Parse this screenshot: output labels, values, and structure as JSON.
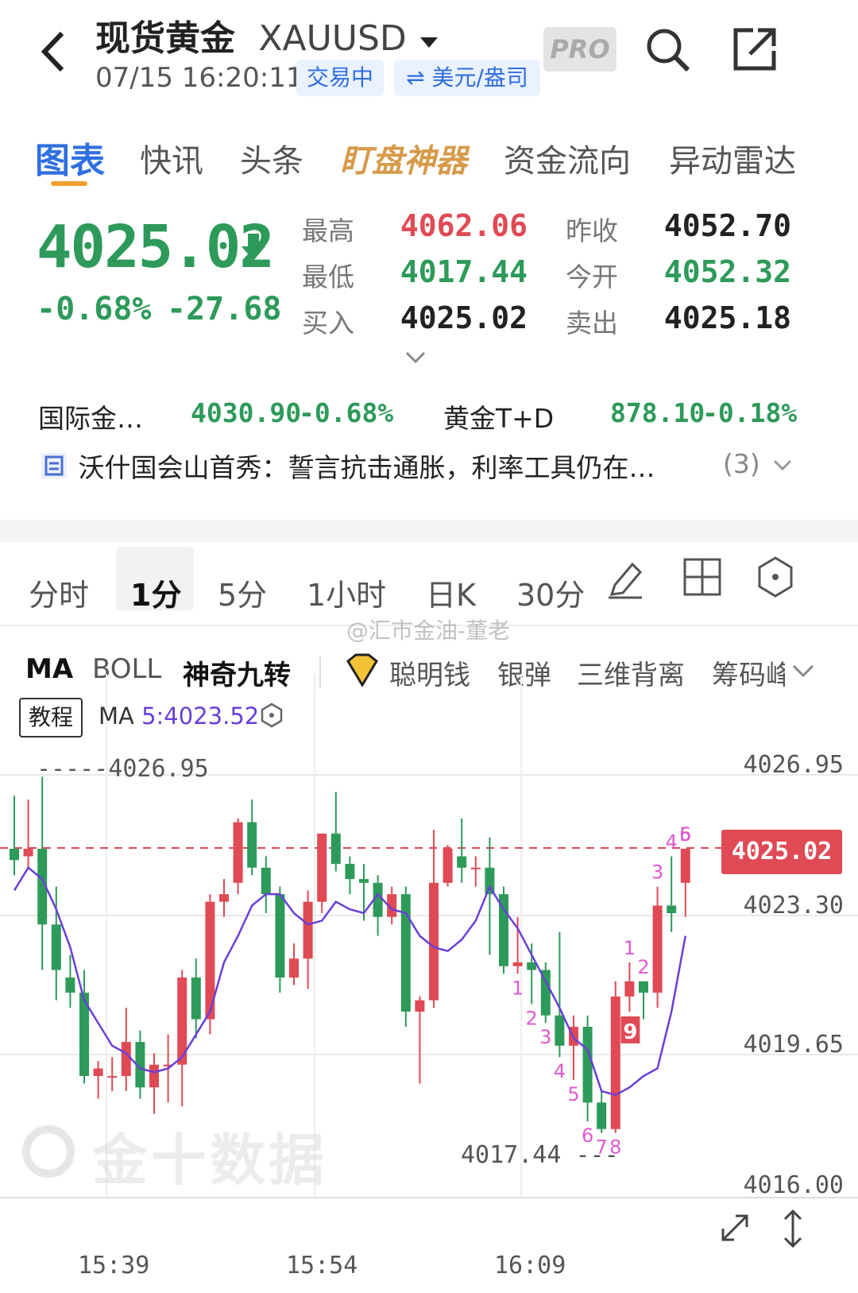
{
  "header": {
    "title": "现货黄金",
    "symbol": "XAUUSD",
    "datetime": "07/15 16:20:11",
    "status": "交易中",
    "unit": "⇌ 美元/盎司",
    "pro_label": "PRO"
  },
  "tabs": [
    "图表",
    "快讯",
    "头条",
    "盯盘神器",
    "资金流向",
    "异动雷达"
  ],
  "quote": {
    "price": "4025.02",
    "change_pct": "-0.68%",
    "change": "-27.68",
    "stats": [
      {
        "label": "最高",
        "value": "4062.06",
        "color": "red"
      },
      {
        "label": "昨收",
        "value": "4052.70",
        "color": "dark"
      },
      {
        "label": "最低",
        "value": "4017.44",
        "color": "green"
      },
      {
        "label": "今开",
        "value": "4052.32",
        "color": "green"
      },
      {
        "label": "买入",
        "value": "4025.02",
        "color": "dark"
      },
      {
        "label": "卖出",
        "value": "4025.18",
        "color": "dark"
      }
    ]
  },
  "related": [
    {
      "name": "国际金…",
      "price": "4030.90",
      "pct": "-0.68%"
    },
    {
      "name": "黄金T+D",
      "price": "878.10",
      "pct": "-0.18%"
    }
  ],
  "news": {
    "text": "沃什国会山首秀：誓言抗击通胀，利率工具仍在…",
    "count": "(3)"
  },
  "period_tabs": [
    "分时",
    "1分",
    "5分",
    "1小时",
    "日K",
    "30分"
  ],
  "indicator_tabs": [
    "MA",
    "BOLL",
    "神奇九转",
    "聪明钱",
    "银弹",
    "三维背离",
    "筹码峰"
  ],
  "watermark": "@汇市金油-董老",
  "chart_header": {
    "tutorial": "教程",
    "ma_label": "MA",
    "ma_value": "5:4023.52"
  },
  "chart_data": {
    "type": "candlestick",
    "y_axis_labels": [
      "4026.95",
      "4023.30",
      "4019.65",
      "4016.00"
    ],
    "ylim": [
      4016.0,
      4026.95
    ],
    "x_tick_labels": [
      "15:39",
      "15:54",
      "16:09"
    ],
    "current_price": "4025.02",
    "high_marker": "4026.95",
    "low_marker": "4017.44",
    "candles": [
      {
        "o": 4025.0,
        "h": 4026.4,
        "l": 4024.3,
        "c": 4024.7
      },
      {
        "o": 4024.8,
        "h": 4026.3,
        "l": 4024.5,
        "c": 4025.0
      },
      {
        "o": 4025.0,
        "h": 4026.9,
        "l": 4021.8,
        "c": 4023.0
      },
      {
        "o": 4023.0,
        "h": 4024.0,
        "l": 4021.0,
        "c": 4021.8
      },
      {
        "o": 4021.6,
        "h": 4022.2,
        "l": 4020.8,
        "c": 4021.2
      },
      {
        "o": 4021.2,
        "h": 4021.8,
        "l": 4018.8,
        "c": 4019.0
      },
      {
        "o": 4019.0,
        "h": 4019.4,
        "l": 4018.4,
        "c": 4019.2
      },
      {
        "o": 4019.0,
        "h": 4019.5,
        "l": 4018.6,
        "c": 4019.0
      },
      {
        "o": 4019.0,
        "h": 4020.8,
        "l": 4018.6,
        "c": 4019.9
      },
      {
        "o": 4019.9,
        "h": 4020.2,
        "l": 4018.4,
        "c": 4018.7
      },
      {
        "o": 4018.7,
        "h": 4019.6,
        "l": 4018.0,
        "c": 4019.3
      },
      {
        "o": 4019.3,
        "h": 4020.1,
        "l": 4018.3,
        "c": 4019.3
      },
      {
        "o": 4019.3,
        "h": 4021.8,
        "l": 4018.2,
        "c": 4021.6
      },
      {
        "o": 4021.6,
        "h": 4022.1,
        "l": 4020.0,
        "c": 4020.5
      },
      {
        "o": 4020.5,
        "h": 4023.8,
        "l": 4020.1,
        "c": 4023.6
      },
      {
        "o": 4023.6,
        "h": 4024.2,
        "l": 4023.2,
        "c": 4023.8
      },
      {
        "o": 4024.1,
        "h": 4025.8,
        "l": 4023.8,
        "c": 4025.7
      },
      {
        "o": 4025.7,
        "h": 4026.3,
        "l": 4024.3,
        "c": 4024.5
      },
      {
        "o": 4024.5,
        "h": 4024.8,
        "l": 4023.3,
        "c": 4023.8
      },
      {
        "o": 4023.8,
        "h": 4024.0,
        "l": 4021.2,
        "c": 4021.6
      },
      {
        "o": 4021.6,
        "h": 4022.5,
        "l": 4021.4,
        "c": 4022.1
      },
      {
        "o": 4022.1,
        "h": 4023.9,
        "l": 4021.3,
        "c": 4023.6
      },
      {
        "o": 4023.6,
        "h": 4025.4,
        "l": 4023.3,
        "c": 4025.4
      },
      {
        "o": 4025.4,
        "h": 4026.5,
        "l": 4024.4,
        "c": 4024.6
      },
      {
        "o": 4024.6,
        "h": 4024.8,
        "l": 4023.8,
        "c": 4024.2
      },
      {
        "o": 4024.2,
        "h": 4024.6,
        "l": 4023.1,
        "c": 4024.1
      },
      {
        "o": 4024.1,
        "h": 4024.3,
        "l": 4022.7,
        "c": 4023.2
      },
      {
        "o": 4023.2,
        "h": 4024.0,
        "l": 4023.0,
        "c": 4023.8
      },
      {
        "o": 4023.8,
        "h": 4024.0,
        "l": 4020.3,
        "c": 4020.7
      },
      {
        "o": 4020.7,
        "h": 4021.1,
        "l": 4018.8,
        "c": 4021.0
      },
      {
        "o": 4021.0,
        "h": 4025.5,
        "l": 4020.8,
        "c": 4024.1
      },
      {
        "o": 4024.1,
        "h": 4025.1,
        "l": 4024.0,
        "c": 4025.0
      },
      {
        "o": 4024.8,
        "h": 4025.8,
        "l": 4024.1,
        "c": 4024.5
      },
      {
        "o": 4024.5,
        "h": 4024.8,
        "l": 4024.0,
        "c": 4024.5
      },
      {
        "o": 4024.5,
        "h": 4025.3,
        "l": 4022.2,
        "c": 4023.8
      },
      {
        "o": 4023.8,
        "h": 4024.0,
        "l": 4021.7,
        "c": 4021.9
      },
      {
        "o": 4021.9,
        "h": 4023.2,
        "l": 4021.7,
        "c": 4022.0
      },
      {
        "o": 4022.0,
        "h": 4022.5,
        "l": 4020.9,
        "c": 4021.8
      },
      {
        "o": 4021.8,
        "h": 4022.0,
        "l": 4020.4,
        "c": 4020.6
      },
      {
        "o": 4020.6,
        "h": 4022.8,
        "l": 4019.5,
        "c": 4019.8
      },
      {
        "o": 4019.8,
        "h": 4020.6,
        "l": 4018.9,
        "c": 4020.3
      },
      {
        "o": 4020.3,
        "h": 4020.6,
        "l": 4017.8,
        "c": 4018.3
      },
      {
        "o": 4018.3,
        "h": 4018.6,
        "l": 4017.5,
        "c": 4017.6
      },
      {
        "o": 4017.6,
        "h": 4021.5,
        "l": 4017.5,
        "c": 4021.1
      },
      {
        "o": 4021.1,
        "h": 4022.0,
        "l": 4020.7,
        "c": 4021.5
      },
      {
        "o": 4021.5,
        "h": 4021.5,
        "l": 4020.5,
        "c": 4021.2
      },
      {
        "o": 4021.2,
        "h": 4024.0,
        "l": 4020.8,
        "c": 4023.5
      },
      {
        "o": 4023.5,
        "h": 4024.8,
        "l": 4022.8,
        "c": 4023.3
      },
      {
        "o": 4024.1,
        "h": 4025.0,
        "l": 4023.2,
        "c": 4025.0
      }
    ],
    "ma5": [
      4023.9,
      4024.5,
      4024.2,
      4023.4,
      4022.4,
      4021.0,
      4020.4,
      4019.8,
      4019.6,
      4019.2,
      4019.1,
      4019.2,
      4019.5,
      4020.1,
      4020.7,
      4022.0,
      4022.7,
      4023.5,
      4023.8,
      4023.8,
      4023.3,
      4023.0,
      4023.1,
      4023.6,
      4023.4,
      4023.3,
      4023.8,
      4023.4,
      4023.3,
      4022.7,
      4022.4,
      4022.3,
      4022.6,
      4023.1,
      4024.0,
      4023.4,
      4022.9,
      4022.2,
      4021.5,
      4020.8,
      4020.0,
      4019.7,
      4018.6,
      4018.5,
      4018.7,
      4019.0,
      4019.2,
      4020.7,
      4022.7
    ]
  },
  "nine_turn_labels": [
    {
      "index": 37,
      "text": "1"
    },
    {
      "index": 38,
      "text": "2"
    },
    {
      "index": 39,
      "text": "3"
    },
    {
      "index": 40,
      "text": "4"
    },
    {
      "index": 41,
      "text": "5"
    },
    {
      "index": 42,
      "text": "6"
    },
    {
      "index": 43,
      "text": "7"
    },
    {
      "index": 44,
      "text": "8"
    },
    {
      "index": 45,
      "text": "9"
    },
    {
      "index": 45,
      "text": "1"
    },
    {
      "index": 46,
      "text": "2"
    },
    {
      "index": 47,
      "text": "3"
    },
    {
      "index": 48,
      "text": "4"
    },
    {
      "index": 49,
      "text": "5"
    },
    {
      "index": 50,
      "text": "6"
    }
  ],
  "brand_watermark": "金十数据"
}
